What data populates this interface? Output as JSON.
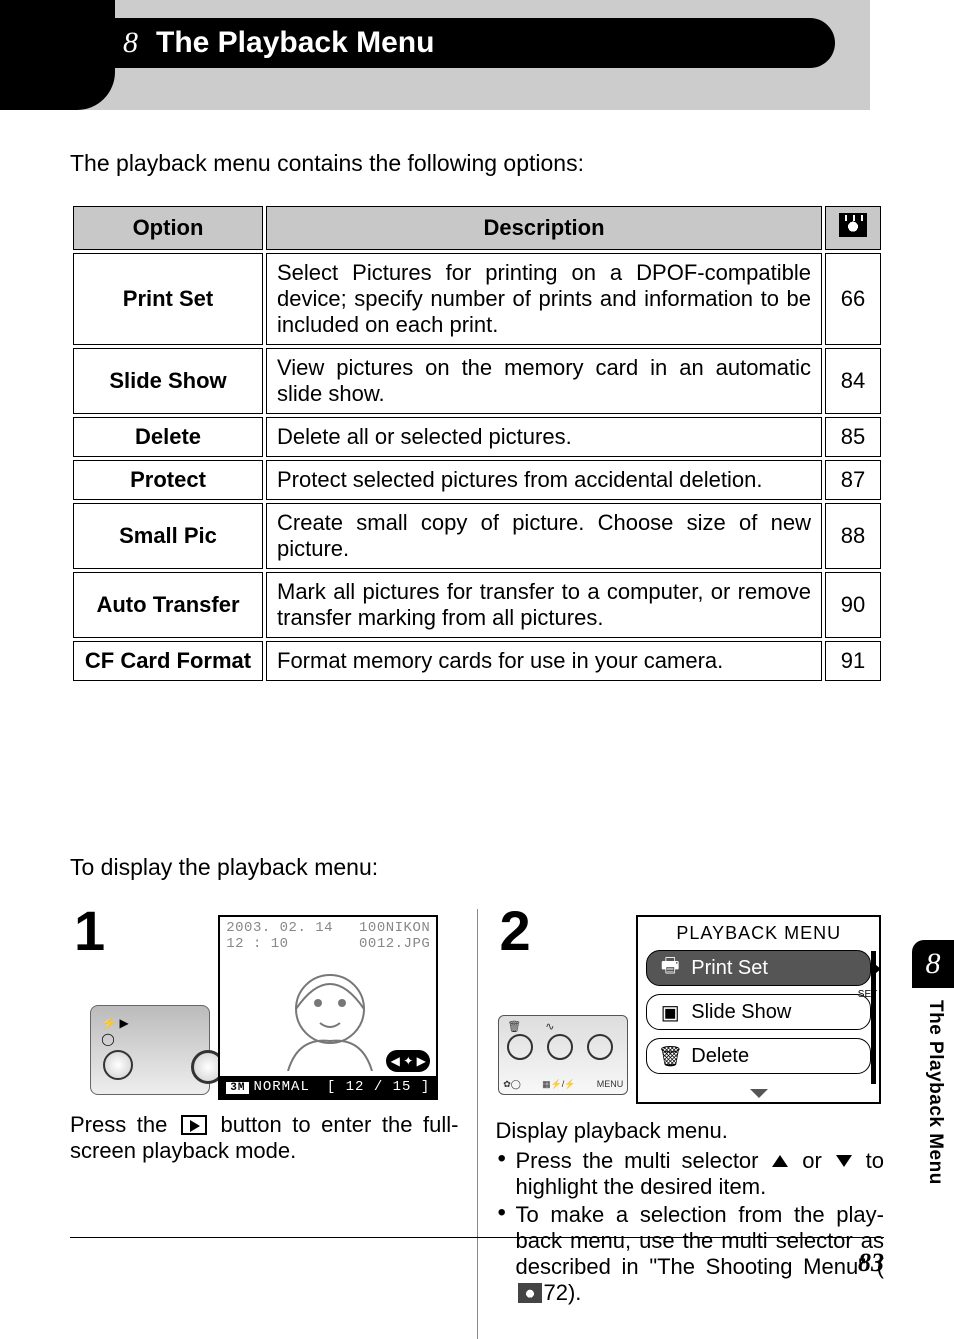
{
  "chapter_glyph": "8",
  "chapter_title": "The Playback Menu",
  "intro": "The playback menu contains the following options:",
  "table": {
    "head": {
      "option": "Option",
      "description": "Description"
    },
    "rows": [
      {
        "option": "Print Set",
        "description": "Select Pictures for printing on a DPOF-compatible device; specify number of prints and information to be included on each print.",
        "page": "66"
      },
      {
        "option": "Slide Show",
        "description": "View pictures on the memory card in an automatic slide show.",
        "page": "84"
      },
      {
        "option": "Delete",
        "description": "Delete all or selected pictures.",
        "page": "85"
      },
      {
        "option": "Protect",
        "description": "Protect selected pictures from accidental deletion.",
        "page": "87"
      },
      {
        "option": "Small Pic",
        "description": "Create small copy of picture. Choose size of new picture.",
        "page": "88"
      },
      {
        "option": "Auto Transfer",
        "description": "Mark all pictures for transfer to a computer, or remove transfer marking from all pictures.",
        "page": "90"
      },
      {
        "option": "CF Card Format",
        "description": "Format memory cards for use in your camera.",
        "page": "91"
      }
    ]
  },
  "subhead": "To display the playback menu:",
  "step1": {
    "num": "1",
    "lcd": {
      "date": "2003. 02. 14",
      "time": "12 : 10",
      "folder": "100NIKON",
      "file": "0012.JPG",
      "badge": "3M",
      "quality": "NORMAL",
      "counter": "[   12  /  15  ]"
    },
    "text_before": "Press the ",
    "text_after": " button to enter the full-screen playback mode."
  },
  "step2": {
    "num": "2",
    "buttons_label_menu": "MENU",
    "menu": {
      "title": "PLAYBACK MENU",
      "items": [
        "Print Set",
        "Slide Show",
        "Delete"
      ],
      "set_label": "SET"
    },
    "line1": "Display playback menu.",
    "bullet1_a": "Press the multi selector ",
    "bullet1_b": " or ",
    "bullet1_c": " to highlight the desired item.",
    "bullet2_a": "To make a selection from the play-back menu, use the multi selector as described in \"The Shooting Menu\" (",
    "bullet2_b": "72)."
  },
  "side_tab_glyph": "8",
  "side_label": "The Playback Menu",
  "page_number": "83"
}
